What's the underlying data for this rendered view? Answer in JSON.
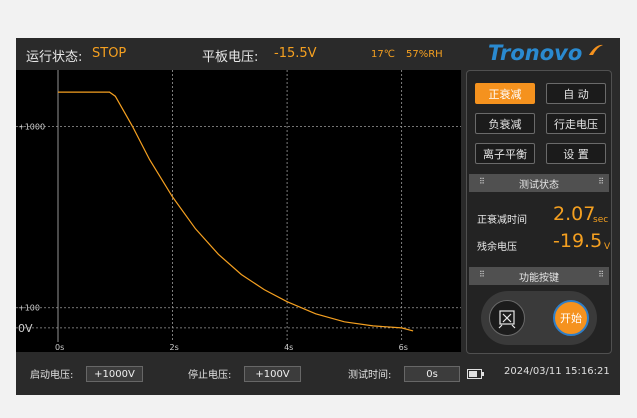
{
  "header": {
    "status_label": "运行状态:",
    "status_value": "STOP",
    "voltage_label": "平板电压:",
    "voltage_value": "-15.5V",
    "temperature": "17℃",
    "humidity": "57%RH",
    "brand": "Tronovo"
  },
  "chart_data": {
    "type": "line",
    "x_ticks": [
      "0s",
      "2s",
      "4s",
      "6s"
    ],
    "y_ticks": [
      "+1000",
      "+100",
      "0V"
    ],
    "xlim": [
      0,
      6.6
    ],
    "ylim": [
      -80,
      1270
    ],
    "series": [
      {
        "x": [
          0,
          0.5,
          0.9,
          1.0,
          1.3,
          1.6,
          2.0,
          2.4,
          2.8,
          3.2,
          3.6,
          4.0,
          4.5,
          5.0,
          5.5,
          6.0,
          6.2
        ],
        "y": [
          1170,
          1170,
          1170,
          1150,
          1000,
          835,
          650,
          492,
          365,
          265,
          190,
          130,
          70,
          30,
          10,
          0,
          -15
        ]
      }
    ]
  },
  "panel": {
    "buttons": [
      {
        "label": "正衰减",
        "active": true
      },
      {
        "label": "自 动",
        "active": false
      },
      {
        "label": "负衰减",
        "active": false
      },
      {
        "label": "行走电压",
        "active": false
      },
      {
        "label": "离子平衡",
        "active": false
      },
      {
        "label": "设 置",
        "active": false
      }
    ],
    "test_status_title": "测试状态",
    "decay_time_label": "正衰减时间",
    "decay_time_value": "2.07",
    "decay_time_unit": "sec",
    "residual_label": "残余电压",
    "residual_value": "-19.5",
    "residual_unit": "V",
    "function_title": "功能按键",
    "start_label": "开始"
  },
  "footer": {
    "start_voltage_label": "启动电压:",
    "start_voltage_value": "+1000V",
    "stop_voltage_label": "停止电压:",
    "stop_voltage_value": "+100V",
    "test_time_label": "测试时间:",
    "test_time_value": "0s",
    "datetime": "2024/03/11 15:16:21"
  },
  "colors": {
    "accent": "#f5921e",
    "curve": "#f5a020",
    "plot_background": "#000000",
    "device_background": "#2a2a2a"
  }
}
